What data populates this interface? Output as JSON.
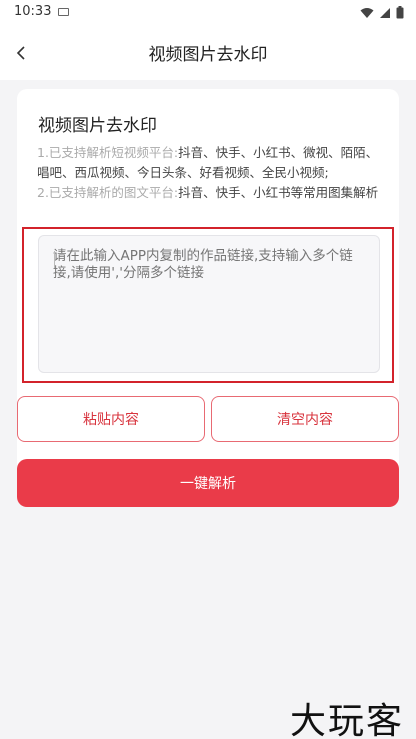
{
  "status_bar": {
    "time": "10:33"
  },
  "nav": {
    "title": "视频图片去水印"
  },
  "card": {
    "title": "视频图片去水印",
    "line1_prefix": "1.已支持解析短视频平台:",
    "line1_platforms": "抖音、快手、小红书、微视、陌陌、唱吧、西瓜视频、今日头条、好看视频、全民小视频;",
    "line2_prefix": "2.已支持解析的图文平台:",
    "line2_platforms": "抖音、快手、小红书等常用图集解析"
  },
  "link_input": {
    "placeholder": "请在此输入APP内复制的作品链接,支持输入多个链接,请使用','分隔多个链接",
    "value": ""
  },
  "buttons": {
    "paste": "粘贴内容",
    "clear": "清空内容",
    "parse": "一键解析"
  },
  "watermark": "大玩客",
  "colors": {
    "accent": "#ea3b49",
    "highlight_border": "#d3232b"
  }
}
